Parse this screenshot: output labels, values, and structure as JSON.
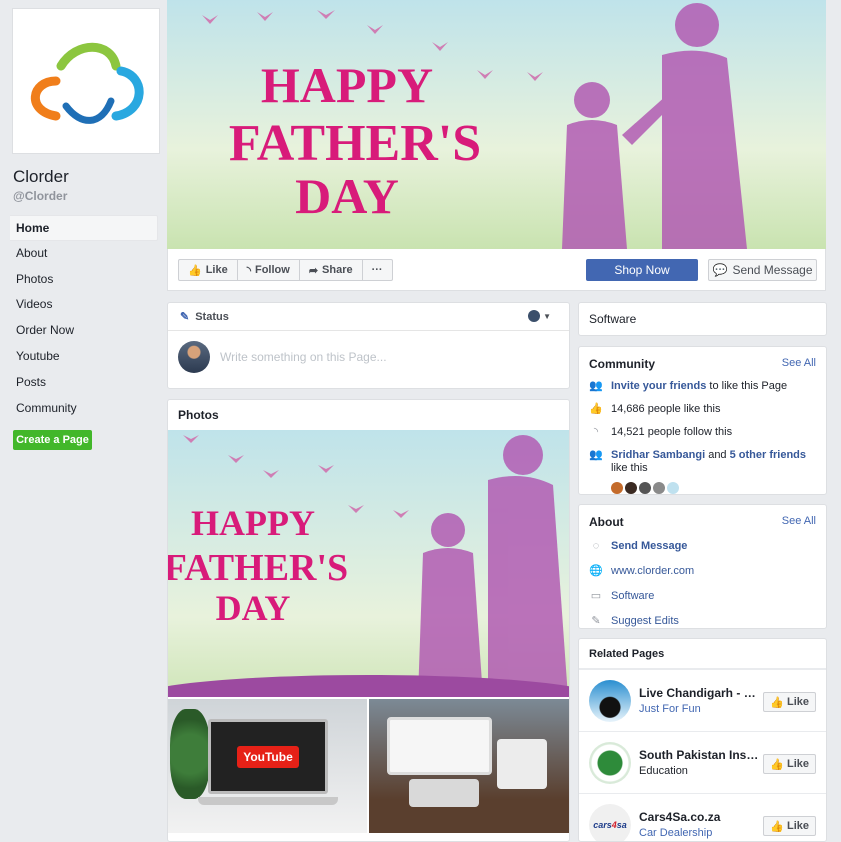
{
  "page": {
    "name": "Clorder",
    "handle": "@Clorder"
  },
  "nav": [
    {
      "label": "Home",
      "active": true
    },
    {
      "label": "About"
    },
    {
      "label": "Photos"
    },
    {
      "label": "Videos"
    },
    {
      "label": "Order Now"
    },
    {
      "label": "Youtube"
    },
    {
      "label": "Posts"
    },
    {
      "label": "Community"
    }
  ],
  "create_page_label": "Create a Page",
  "cover": {
    "line1": "HAPPY",
    "line2": "FATHER'S",
    "line3": "DAY"
  },
  "actions": {
    "like": "Like",
    "follow": "Follow",
    "share": "Share",
    "more": "···",
    "shop": "Shop Now",
    "message": "Send Message"
  },
  "status": {
    "label": "Status",
    "placeholder": "Write something on this Page..."
  },
  "photos": {
    "title": "Photos",
    "thumb1": "YouTube"
  },
  "software": {
    "label": "Software"
  },
  "community": {
    "title": "Community",
    "see_all": "See All",
    "invite_link": "Invite your friends",
    "invite_rest": " to like this Page",
    "likes": "14,686 people like this",
    "follows": "14,521 people follow this",
    "friend1": "Sridhar Sambangi",
    "friend_and": " and ",
    "friend_others": "5 other friends",
    "friend_rest": " like this"
  },
  "about": {
    "title": "About",
    "see_all": "See All",
    "send_message": "Send Message",
    "website": "www.clorder.com",
    "category": "Software",
    "suggest": "Suggest Edits"
  },
  "related": {
    "title": "Related Pages",
    "like": "Like",
    "items": [
      {
        "name": "Live Chandigarh - Liv...",
        "category": "Just For Fun"
      },
      {
        "name": "South Pakistan Institut...",
        "category": "Education"
      },
      {
        "name": "Cars4Sa.co.za",
        "category": "Car Dealership"
      }
    ]
  },
  "colors": {
    "brand": "#4267b2",
    "create": "#42b72a",
    "cover_text": "#d81b7a"
  }
}
